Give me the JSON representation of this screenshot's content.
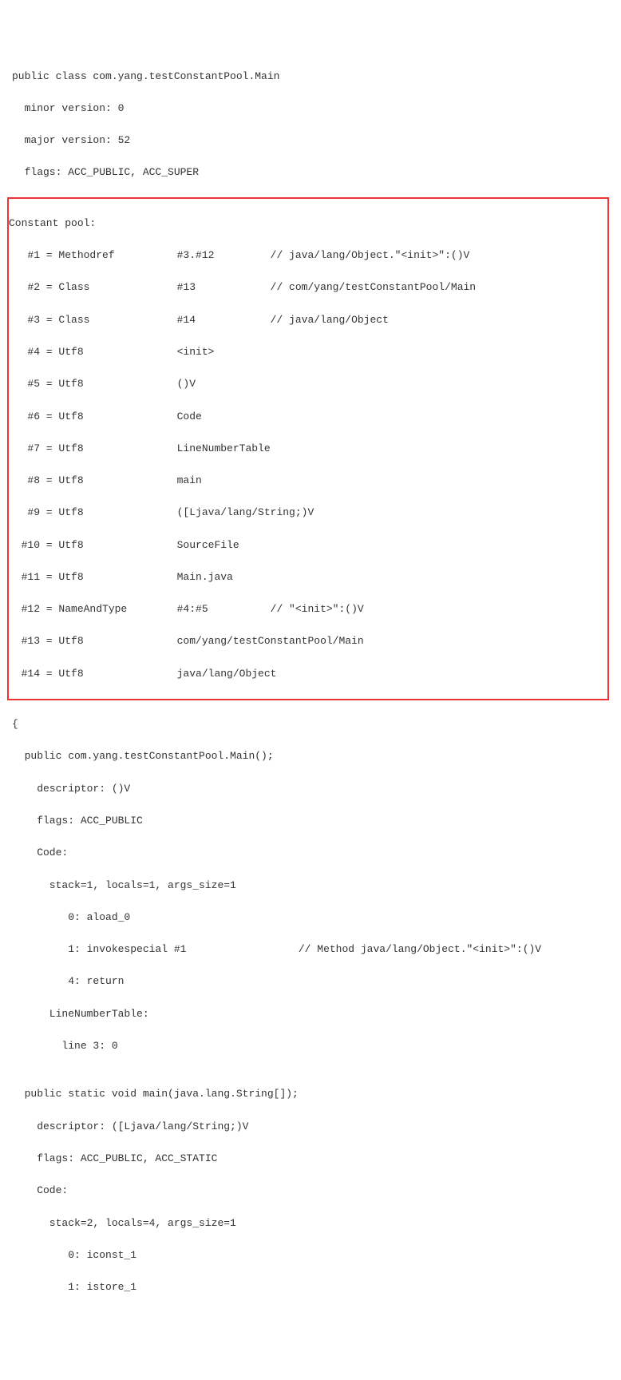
{
  "header": {
    "class": "public class com.yang.testConstantPool.Main",
    "minor": "  minor version: 0",
    "major": "  major version: 52",
    "flags": "  flags: ACC_PUBLIC, ACC_SUPER"
  },
  "cp": {
    "title": "Constant pool:",
    "rows": [
      "   #1 = Methodref          #3.#12         // java/lang/Object.\"<init>\":()V",
      "   #2 = Class              #13            // com/yang/testConstantPool/Main",
      "   #3 = Class              #14            // java/lang/Object",
      "   #4 = Utf8               <init>",
      "   #5 = Utf8               ()V",
      "   #6 = Utf8               Code",
      "   #7 = Utf8               LineNumberTable",
      "   #8 = Utf8               main",
      "   #9 = Utf8               ([Ljava/lang/String;)V",
      "  #10 = Utf8               SourceFile",
      "  #11 = Utf8               Main.java",
      "  #12 = NameAndType        #4:#5          // \"<init>\":()V",
      "  #13 = Utf8               com/yang/testConstantPool/Main",
      "  #14 = Utf8               java/lang/Object"
    ]
  },
  "body": [
    "{",
    "  public com.yang.testConstantPool.Main();",
    "    descriptor: ()V",
    "    flags: ACC_PUBLIC",
    "    Code:",
    "      stack=1, locals=1, args_size=1",
    "         0: aload_0",
    "         1: invokespecial #1                  // Method java/lang/Object.\"<init>\":()V",
    "         4: return",
    "      LineNumberTable:",
    "        line 3: 0",
    "",
    "  public static void main(java.lang.String[]);",
    "    descriptor: ([Ljava/lang/String;)V",
    "    flags: ACC_PUBLIC, ACC_STATIC",
    "    Code:",
    "      stack=2, locals=4, args_size=1",
    "         0: iconst_1",
    "         1: istore_1"
  ]
}
